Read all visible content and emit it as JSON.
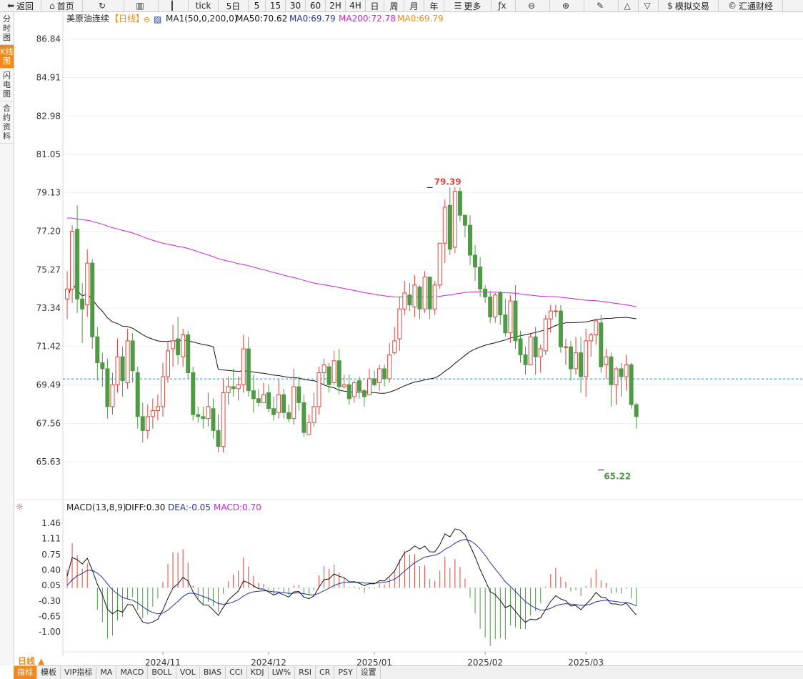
{
  "toolbar": [
    {
      "label": "返回",
      "icon": "back-arrow-icon",
      "glyph": "⬅",
      "w": 58
    },
    {
      "label": "首页",
      "icon": "home-icon",
      "glyph": "⌂",
      "w": 58
    },
    {
      "label": "",
      "icon": "refresh-icon",
      "glyph": "↻",
      "w": 58
    },
    {
      "label": "",
      "icon": "bar-chart-icon",
      "glyph": "▥",
      "w": 48
    },
    {
      "label": "",
      "icon": "candlestick-icon",
      "glyph": "┃",
      "w": 42
    },
    {
      "label": "tick",
      "icon": "",
      "glyph": "",
      "w": 42
    },
    {
      "label": "5日",
      "icon": "",
      "glyph": "",
      "w": 42
    },
    {
      "label": "5",
      "icon": "",
      "glyph": "",
      "w": 24
    },
    {
      "label": "15",
      "icon": "",
      "glyph": "",
      "w": 28
    },
    {
      "label": "30",
      "icon": "",
      "glyph": "",
      "w": 28
    },
    {
      "label": "60",
      "icon": "",
      "glyph": "",
      "w": 28
    },
    {
      "label": "2H",
      "icon": "",
      "glyph": "",
      "w": 28
    },
    {
      "label": "4H",
      "icon": "",
      "glyph": "",
      "w": 28
    },
    {
      "label": "日",
      "icon": "",
      "glyph": "",
      "w": 26
    },
    {
      "label": "周",
      "icon": "",
      "glyph": "",
      "w": 28
    },
    {
      "label": "月",
      "icon": "",
      "glyph": "",
      "w": 28
    },
    {
      "label": "年",
      "icon": "",
      "glyph": "",
      "w": 28
    },
    {
      "label": "更多",
      "icon": "menu-icon",
      "glyph": "☰",
      "w": 66
    },
    {
      "label": "",
      "icon": "fx-icon",
      "glyph": "ƒx",
      "w": 34
    },
    {
      "label": "",
      "icon": "zoom-out-icon",
      "glyph": "⊖",
      "w": 48
    },
    {
      "label": "",
      "icon": "zoom-in-icon",
      "glyph": "⊕",
      "w": 48
    },
    {
      "label": "",
      "icon": "draw-line-icon",
      "glyph": "✎",
      "w": 48
    },
    {
      "label": "",
      "icon": "triangle-up-icon",
      "glyph": "△",
      "w": 28
    },
    {
      "label": "",
      "icon": "triangle-down-icon",
      "glyph": "▽",
      "w": 28
    },
    {
      "label": "模拟交易",
      "icon": "dollar-icon",
      "glyph": "$",
      "w": 84
    },
    {
      "label": "汇通财经",
      "icon": "hc-logo-icon",
      "glyph": "©",
      "w": 90
    }
  ],
  "leftnav": [
    {
      "label": "分时图",
      "active": false
    },
    {
      "label": "K线图",
      "active": true
    },
    {
      "label": "闪电图",
      "active": false
    },
    {
      "label": "合约资料",
      "active": false
    }
  ],
  "header": {
    "symbol": "美原油连续",
    "period_tag": "【日线】",
    "ma_group": "MA1(50,0,200,0)",
    "ma50": "MA50:70.62",
    "ma0a": "MA0:69.79",
    "ma200": "MA200:72.78",
    "ma0b": "MA0:69.79"
  },
  "macd_header": {
    "title": "MACD(13,8,9)",
    "diff": "DIFF:0.30",
    "dea": "DEA:-0.05",
    "macd": "MACD:0.70"
  },
  "bottom_period": "日线 ▲",
  "bottom_tabs": [
    {
      "label": "指标",
      "active": true
    },
    {
      "label": "模板",
      "active": false
    },
    {
      "label": "VIP指标",
      "active": false
    },
    {
      "label": "MA",
      "active": false
    },
    {
      "label": "MACD",
      "active": false
    },
    {
      "label": "BOLL",
      "active": false
    },
    {
      "label": "VOL",
      "active": false
    },
    {
      "label": "BIAS",
      "active": false
    },
    {
      "label": "CCI",
      "active": false
    },
    {
      "label": "KDJ",
      "active": false
    },
    {
      "label": "LW%",
      "active": false
    },
    {
      "label": "RSI",
      "active": false
    },
    {
      "label": "CR",
      "active": false
    },
    {
      "label": "PSY",
      "active": false
    },
    {
      "label": "设置",
      "active": false
    }
  ],
  "colors": {
    "up": "#e0443c",
    "down": "#4e9a45",
    "ma50": "#111111",
    "ma200": "#d21fd8",
    "current": "#2b86c4",
    "dea": "#2135a0",
    "diff": "#111111"
  },
  "chart_data": [
    {
      "type": "candlestick",
      "title": "美原油连续",
      "y_ticks": [
        "86.84",
        "84.91",
        "82.98",
        "81.05",
        "79.13",
        "77.20",
        "75.27",
        "73.34",
        "71.42",
        "69.49",
        "67.56",
        "65.63"
      ],
      "ylim": [
        63.7,
        87.4
      ],
      "x_labels": [
        {
          "label": "2024/11",
          "index": 19
        },
        {
          "label": "2024/12",
          "index": 40
        },
        {
          "label": "2025/01",
          "index": 61
        },
        {
          "label": "2025/02",
          "index": 83
        },
        {
          "label": "2025/03",
          "index": 103
        }
      ],
      "current_price": 69.79,
      "high_marker": {
        "label": "79.39",
        "value": 79.39,
        "index": 72
      },
      "low_marker": {
        "label": "65.22",
        "value": 65.22,
        "index": 106
      },
      "candles": [
        [
          73.8,
          74.3,
          72.8,
          75.2
        ],
        [
          74.3,
          77.2,
          73.6,
          77.5
        ],
        [
          77.3,
          73.8,
          73.1,
          78.5
        ],
        [
          73.8,
          73.3,
          71.6,
          74.6
        ],
        [
          73.5,
          75.6,
          72.9,
          76.3
        ],
        [
          75.6,
          71.9,
          71.3,
          75.8
        ],
        [
          71.9,
          70.6,
          69.7,
          72.4
        ],
        [
          70.6,
          70.3,
          69.4,
          71.1
        ],
        [
          70.3,
          68.4,
          67.8,
          70.8
        ],
        [
          68.4,
          69.5,
          68.0,
          70.1
        ],
        [
          69.5,
          70.9,
          69.1,
          71.8
        ],
        [
          70.9,
          69.7,
          68.9,
          71.4
        ],
        [
          69.6,
          71.7,
          69.3,
          72.3
        ],
        [
          71.7,
          70.2,
          69.6,
          72.1
        ],
        [
          70.1,
          67.9,
          67.3,
          70.4
        ],
        [
          67.9,
          67.2,
          66.6,
          68.6
        ],
        [
          67.2,
          67.9,
          66.8,
          68.5
        ],
        [
          67.9,
          68.2,
          67.3,
          68.8
        ],
        [
          68.2,
          68.4,
          67.7,
          69.0
        ],
        [
          68.4,
          69.9,
          67.9,
          70.6
        ],
        [
          69.9,
          71.2,
          69.6,
          71.7
        ],
        [
          71.3,
          71.7,
          70.4,
          72.5
        ],
        [
          71.8,
          71.0,
          70.5,
          72.9
        ],
        [
          70.9,
          72.0,
          70.4,
          72.3
        ],
        [
          72.0,
          70.1,
          69.8,
          72.2
        ],
        [
          70.1,
          68.0,
          67.7,
          70.4
        ],
        [
          68.0,
          67.9,
          67.6,
          68.4
        ],
        [
          67.9,
          67.8,
          67.3,
          68.4
        ],
        [
          67.8,
          68.4,
          67.4,
          69.1
        ],
        [
          68.3,
          67.2,
          66.8,
          68.8
        ],
        [
          67.2,
          66.4,
          66.1,
          68.0
        ],
        [
          66.4,
          69.1,
          66.1,
          69.8
        ],
        [
          69.1,
          69.4,
          68.5,
          69.9
        ],
        [
          69.4,
          69.3,
          68.9,
          70.3
        ],
        [
          69.3,
          69.5,
          68.7,
          69.9
        ],
        [
          69.5,
          71.3,
          69.1,
          72.0
        ],
        [
          71.3,
          69.2,
          68.9,
          71.9
        ],
        [
          69.2,
          68.8,
          68.1,
          70.0
        ],
        [
          68.8,
          68.6,
          68.4,
          69.3
        ],
        [
          68.6,
          69.0,
          68.6,
          69.6
        ],
        [
          69.1,
          68.3,
          68.1,
          69.5
        ],
        [
          68.3,
          68.0,
          67.7,
          68.9
        ],
        [
          68.1,
          69.0,
          67.8,
          69.8
        ],
        [
          69.0,
          68.1,
          67.8,
          69.3
        ],
        [
          68.1,
          67.8,
          67.6,
          68.5
        ],
        [
          67.8,
          69.4,
          67.5,
          70.3
        ],
        [
          69.4,
          68.6,
          68.2,
          69.9
        ],
        [
          68.6,
          67.1,
          66.9,
          69.0
        ],
        [
          67.0,
          67.6,
          67.1,
          68.0
        ],
        [
          67.6,
          68.4,
          67.4,
          69.1
        ],
        [
          68.4,
          70.1,
          68.0,
          70.4
        ],
        [
          70.1,
          70.5,
          69.5,
          70.8
        ],
        [
          70.4,
          69.5,
          69.1,
          70.6
        ],
        [
          69.6,
          70.7,
          69.5,
          71.2
        ],
        [
          70.7,
          69.4,
          69.0,
          71.3
        ],
        [
          69.4,
          69.5,
          69.3,
          70.0
        ],
        [
          69.5,
          68.8,
          68.5,
          70.0
        ],
        [
          68.9,
          69.6,
          68.6,
          69.7
        ],
        [
          69.7,
          69.2,
          68.8,
          69.9
        ],
        [
          69.2,
          68.9,
          68.4,
          69.3
        ],
        [
          69.0,
          69.8,
          69.0,
          70.3
        ],
        [
          69.8,
          69.5,
          69.4,
          70.2
        ],
        [
          69.6,
          70.3,
          69.2,
          70.5
        ],
        [
          70.3,
          69.8,
          69.4,
          70.5
        ],
        [
          69.8,
          71.0,
          69.6,
          71.6
        ],
        [
          71.1,
          71.7,
          71.0,
          72.4
        ],
        [
          71.8,
          73.3,
          71.2,
          73.9
        ],
        [
          73.3,
          74.1,
          73.0,
          74.7
        ],
        [
          74.0,
          73.5,
          73.2,
          74.6
        ],
        [
          73.4,
          74.5,
          72.9,
          75.0
        ],
        [
          74.4,
          73.3,
          72.8,
          74.5
        ],
        [
          73.3,
          74.9,
          73.1,
          75.2
        ],
        [
          74.9,
          73.3,
          72.8,
          74.9
        ],
        [
          73.3,
          74.5,
          73.0,
          74.7
        ],
        [
          74.5,
          76.6,
          74.3,
          76.6
        ],
        [
          76.6,
          78.4,
          75.6,
          78.8
        ],
        [
          78.5,
          76.3,
          76.0,
          79.4
        ],
        [
          76.4,
          79.2,
          76.1,
          79.4
        ],
        [
          79.2,
          78.0,
          77.7,
          79.4
        ],
        [
          78.0,
          77.5,
          76.9,
          77.9
        ],
        [
          77.5,
          76.0,
          75.5,
          78.0
        ],
        [
          76.0,
          75.4,
          74.7,
          76.5
        ],
        [
          75.4,
          74.3,
          73.9,
          75.9
        ],
        [
          74.3,
          73.9,
          73.6,
          74.5
        ],
        [
          73.9,
          72.9,
          72.6,
          74.2
        ],
        [
          72.9,
          74.0,
          72.6,
          74.1
        ],
        [
          74.1,
          73.0,
          72.5,
          74.2
        ],
        [
          73.0,
          72.1,
          71.9,
          73.8
        ],
        [
          72.1,
          73.7,
          71.6,
          74.0
        ],
        [
          73.7,
          71.7,
          71.3,
          74.5
        ],
        [
          71.8,
          71.0,
          70.6,
          72.2
        ],
        [
          71.0,
          70.5,
          70.0,
          71.4
        ],
        [
          70.5,
          71.9,
          70.5,
          72.1
        ],
        [
          71.9,
          70.9,
          70.0,
          72.4
        ],
        [
          70.9,
          71.3,
          70.1,
          71.5
        ],
        [
          71.2,
          72.8,
          71.0,
          73.0
        ],
        [
          72.8,
          73.2,
          72.1,
          73.5
        ],
        [
          73.2,
          73.2,
          72.9,
          73.5
        ],
        [
          73.2,
          71.4,
          71.1,
          73.5
        ],
        [
          71.4,
          71.4,
          70.5,
          71.8
        ],
        [
          71.4,
          70.3,
          69.7,
          71.7
        ],
        [
          70.3,
          71.1,
          70.0,
          71.9
        ],
        [
          71.1,
          69.9,
          69.1,
          71.9
        ],
        [
          69.9,
          71.7,
          68.9,
          72.3
        ],
        [
          71.7,
          72.0,
          70.9,
          72.1
        ],
        [
          72.0,
          72.7,
          71.5,
          72.8
        ],
        [
          72.6,
          70.4,
          70.1,
          73.0
        ],
        [
          70.5,
          70.9,
          69.8,
          71.3
        ],
        [
          70.9,
          69.5,
          68.4,
          71.1
        ],
        [
          69.5,
          70.3,
          68.5,
          70.4
        ],
        [
          70.3,
          69.9,
          68.9,
          70.6
        ],
        [
          69.9,
          70.5,
          69.2,
          71.0
        ],
        [
          70.5,
          68.5,
          68.3,
          70.6
        ],
        [
          68.5,
          67.9,
          67.3,
          68.6
        ]
      ]
    },
    {
      "type": "macd",
      "title": "MACD(13,8,9)",
      "y_ticks": [
        "1.46",
        "1.11",
        "0.75",
        "0.40",
        "0.05",
        "-0.30",
        "-0.65",
        "-1.00"
      ],
      "ylim": [
        -1.45,
        1.62
      ]
    }
  ]
}
